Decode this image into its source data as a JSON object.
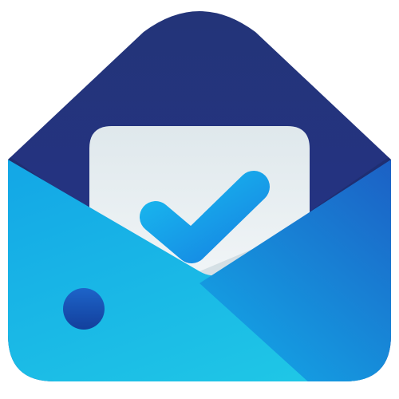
{
  "icon": {
    "name": "inbox-app-icon",
    "parts": [
      "envelope-icon",
      "letter-card",
      "checkmark-icon",
      "indicator-dot"
    ]
  },
  "colors": {
    "background": "#ffffff",
    "flap_top": "#233478",
    "flap_bottom": "#25328a",
    "flap_shade": "#1c2a66",
    "envelope_light": "#1fc6e6",
    "envelope_mid": "#13a6e6",
    "envelope_dark": "#1c5fc4",
    "letter_light": "#f1f5f7",
    "letter_shade": "#d6e1e6",
    "check_light": "#18b7ee",
    "check_dark": "#1687e3",
    "dot_top": "#1d64c9",
    "dot_bottom": "#133f9c"
  }
}
